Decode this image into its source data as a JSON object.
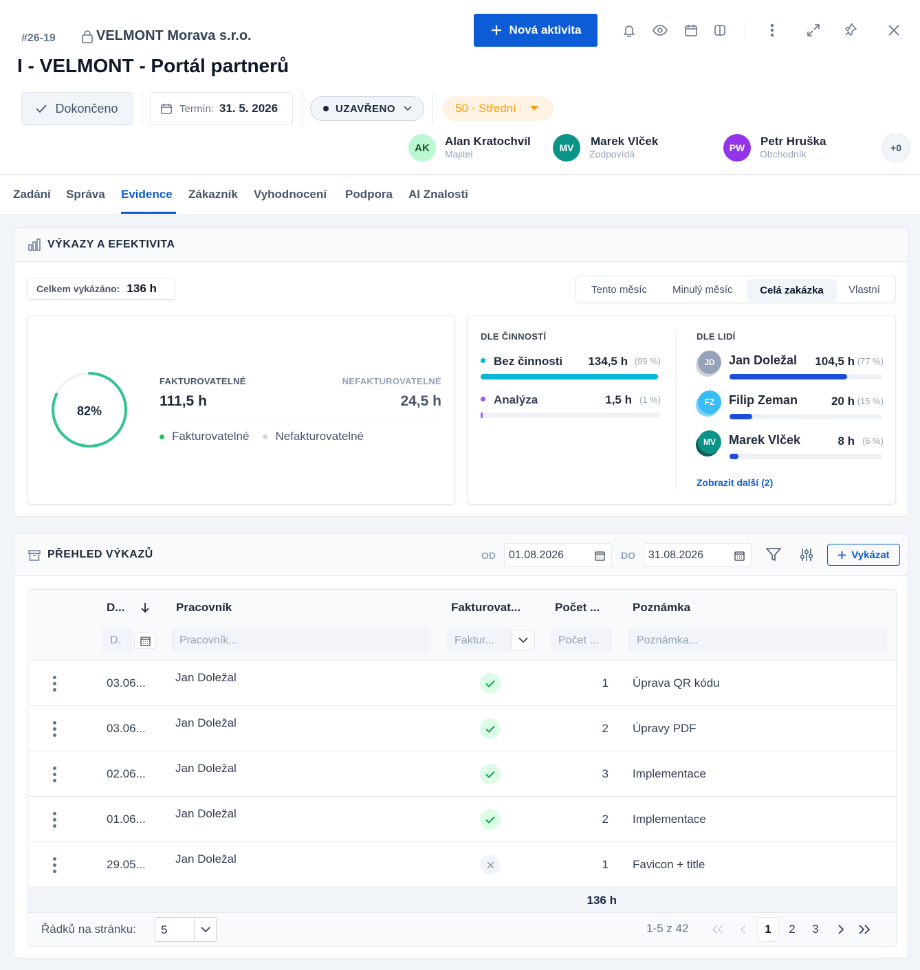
{
  "header": {
    "id": "#26-19",
    "company": "VELMONT Morava s.r.o.",
    "title": "I - VELMONT - Portál partnerů",
    "new_activity": "Nová aktivita",
    "done_label": "Dokončeno",
    "deadline_label": "Termín:",
    "deadline_value": "31. 5. 2026",
    "state": "UZAVŘENO",
    "priority": "50 - Střední",
    "people": [
      {
        "initials": "AK",
        "name": "Alan Kratochvíl",
        "role": "Majitel",
        "color": "#bbf7d0",
        "fg": "#14532d"
      },
      {
        "initials": "MV",
        "name": "Marek Vlček",
        "role": "Zodpovídá",
        "color": "#0d9488",
        "fg": "#ffffff"
      },
      {
        "initials": "PW",
        "name": "Petr Hruška",
        "role": "Obchodník",
        "color": "#9333ea",
        "fg": "#ffffff"
      }
    ],
    "more_people": "+0"
  },
  "tabs": [
    "Zadání",
    "Správa",
    "Evidence",
    "Zákazník",
    "Vyhodnocení",
    "Podpora",
    "AI Znalosti"
  ],
  "active_tab": "Evidence",
  "efficiency": {
    "title": "VÝKAZY A EFEKTIVITA",
    "total_label": "Celkem vykázáno:",
    "total_value": "136 h",
    "periods": [
      "Tento měsíc",
      "Minulý měsíc",
      "Celá zakázka",
      "Vlastní"
    ],
    "active_period": "Celá zakázka",
    "percent": "82%",
    "percent_value": 0.82,
    "billable_label": "FAKTUROVATELNÉ",
    "billable_value": "111,5 h",
    "nonbillable_label": "NEFAKTUROVATELNÉ",
    "nonbillable_value": "24,5 h",
    "legend_billable": "Fakturovatelné",
    "legend_nonbillable": "Nefakturovatelné",
    "by_activity_title": "DLE ČINNOSTÍ",
    "activities": [
      {
        "name": "Bez činnosti",
        "hours": "134,5 h",
        "pct": "(99 %)",
        "fraction": 0.99,
        "color": "#06b6d4"
      },
      {
        "name": "Analýza",
        "hours": "1,5 h",
        "pct": "(1 %)",
        "fraction": 0.01,
        "color": "#a855f7"
      }
    ],
    "by_people_title": "DLE LIDÍ",
    "people": [
      {
        "initials": "JD",
        "name": "Jan Doležal",
        "hours": "104,5 h",
        "pct": "(77 %)",
        "fraction": 0.77,
        "color": "#94a3b8"
      },
      {
        "initials": "FZ",
        "name": "Filip Zeman",
        "hours": "20 h",
        "pct": "(15 %)",
        "fraction": 0.15,
        "color": "#38bdf8"
      },
      {
        "initials": "MV",
        "name": "Marek Vlček",
        "hours": "8 h",
        "pct": "(6 %)",
        "fraction": 0.06,
        "color": "#0d9488"
      }
    ],
    "show_more": "Zobrazit další (2)"
  },
  "reports": {
    "title": "PŘEHLED VÝKAZŮ",
    "from_label": "OD",
    "from_value": "01.08.2026",
    "to_label": "DO",
    "to_value": "31.08.2026",
    "add_label": "Vykázat",
    "columns": {
      "date": "D...",
      "worker": "Pracovník",
      "billable": "Fakturovat...",
      "count": "Počet ...",
      "note": "Poznámka"
    },
    "filters": {
      "date": "D.",
      "worker": "Pracovník...",
      "billable": "Faktur...",
      "count": "Počet ...",
      "note": "Poznámka..."
    },
    "rows": [
      {
        "date": "03.06...",
        "worker": "Jan Doležal",
        "billable": true,
        "count": "1",
        "note": "Úprava QR kódu"
      },
      {
        "date": "03.06...",
        "worker": "Jan Doležal",
        "billable": true,
        "count": "2",
        "note": "Úpravy PDF"
      },
      {
        "date": "02.06...",
        "worker": "Jan Doležal",
        "billable": true,
        "count": "3",
        "note": "Implementace"
      },
      {
        "date": "01.06...",
        "worker": "Jan Doležal",
        "billable": true,
        "count": "2",
        "note": "Implementace"
      },
      {
        "date": "29.05...",
        "worker": "Jan Doležal",
        "billable": false,
        "count": "1",
        "note": "Favicon + title"
      }
    ],
    "total": "136 h",
    "rows_per_page_label": "Řádků na stránku:",
    "rows_per_page": "5",
    "range": "1-5 z 42",
    "pages": [
      "1",
      "2",
      "3"
    ],
    "current_page": "1"
  }
}
